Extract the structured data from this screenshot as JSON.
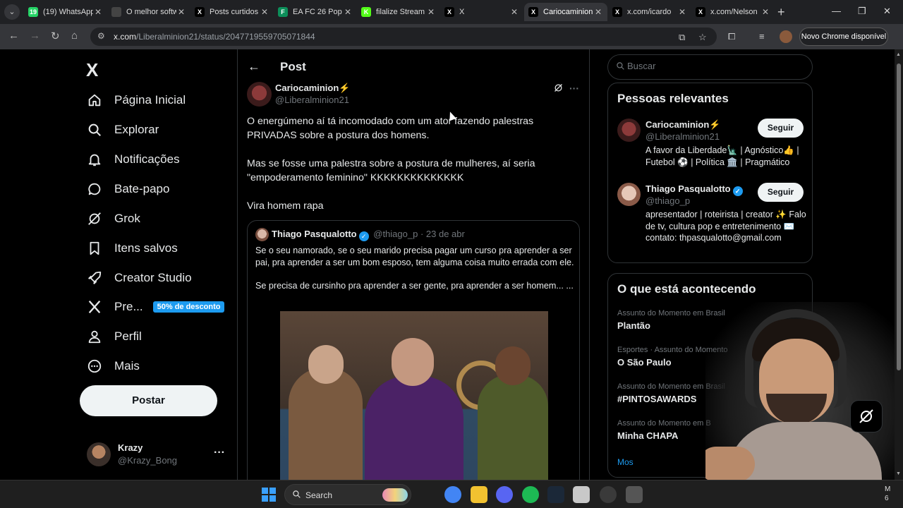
{
  "browser": {
    "tabs": [
      {
        "title": "(19) WhatsApp",
        "favicon": "whatsapp-icon",
        "color": "#25d366",
        "mark": "19"
      },
      {
        "title": "O melhor software",
        "favicon": "shield-icon",
        "color": "#444444",
        "mark": ""
      },
      {
        "title": "Posts curtidos",
        "favicon": "x-icon",
        "color": "#000000",
        "mark": "X"
      },
      {
        "title": "EA FC 26 Pop",
        "favicon": "futbin-icon",
        "color": "#0c8f5a",
        "mark": "F"
      },
      {
        "title": "filalize Stream",
        "favicon": "kick-icon",
        "color": "#53fc18",
        "mark": "K"
      },
      {
        "title": "X",
        "favicon": "x-icon",
        "color": "#000000",
        "mark": "X"
      },
      {
        "title": "Cariocaminion",
        "favicon": "x-icon",
        "color": "#000000",
        "mark": "X",
        "active": true
      },
      {
        "title": "x.com/icardo",
        "favicon": "x-icon",
        "color": "#000000",
        "mark": "X"
      },
      {
        "title": "x.com/Nelson",
        "favicon": "x-icon",
        "color": "#000000",
        "mark": "X"
      }
    ],
    "url_host": "x.com",
    "url_path": "/Liberalminion21/status/2047719559705071844",
    "update_label": "Novo Chrome disponível"
  },
  "sidebar": {
    "logo": "X",
    "items": [
      {
        "label": "Página Inicial",
        "icon": "home-icon"
      },
      {
        "label": "Explorar",
        "icon": "search-icon"
      },
      {
        "label": "Notificações",
        "icon": "bell-icon"
      },
      {
        "label": "Bate-papo",
        "icon": "chat-icon"
      },
      {
        "label": "Grok",
        "icon": "grok-icon"
      },
      {
        "label": "Itens salvos",
        "icon": "bookmark-icon"
      },
      {
        "label": "Creator Studio",
        "icon": "rocket-icon"
      },
      {
        "label": "Pre...",
        "icon": "x-premium-icon",
        "badge": "50% de desconto"
      },
      {
        "label": "Perfil",
        "icon": "person-icon"
      },
      {
        "label": "Mais",
        "icon": "more-circle-icon"
      }
    ],
    "post_button": "Postar",
    "account": {
      "name": "Krazy",
      "handle": "@Krazy_Bong"
    }
  },
  "post": {
    "header": "Post",
    "author": {
      "name": "Cariocaminion⚡",
      "handle": "@Liberalminion21"
    },
    "paragraphs": [
      "O energúmeno aí tá incomodado com um ator fazendo palestras PRIVADAS sobre a postura dos homens.",
      "Mas se fosse uma palestra sobre a postura de mulheres, aí seria \"empoderamento feminino\" KKKKKKKKKKKKKK",
      "Vira homem rapa"
    ],
    "quote": {
      "name": "Thiago Pasqualotto",
      "handle": "@thiago_p",
      "date": "23 de abr",
      "paragraphs": [
        "Se o seu namorado, se o seu marido precisa pagar um curso pra aprender a ser pai, pra aprender a ser um bom esposo, tem alguma coisa muito errada com ele.",
        "Se precisa de cursinho pra aprender a ser gente, pra aprender a ser homem... ..."
      ]
    }
  },
  "right": {
    "search_placeholder": "Buscar",
    "relevant_title": "Pessoas relevantes",
    "people": [
      {
        "name": "Cariocaminion⚡",
        "handle": "@Liberalminion21",
        "bio": "A favor da Liberdade🗽 | Agnóstico👍 | Futebol ⚽ | Política 🏛️ | Pragmático",
        "follow": "Seguir",
        "verified": false
      },
      {
        "name": "Thiago Pasqualotto",
        "handle": "@thiago_p",
        "bio": "apresentador | roteirista | creator ✨ Falo de tv, cultura pop e entretenimento ✉️ contato: thpasqualotto@gmail.com",
        "follow": "Seguir",
        "verified": true
      }
    ],
    "trends_title": "O que está acontecendo",
    "trends": [
      {
        "context": "Assunto do Momento em Brasil",
        "name": "Plantão"
      },
      {
        "context": "Esportes · Assunto do Momento",
        "name": "O São Paulo"
      },
      {
        "context": "Assunto do Momento em Brasil",
        "name": "#PINTOSAWARDS"
      },
      {
        "context": "Assunto do Momento em B",
        "name": "Minha CHAPA"
      }
    ],
    "show_more": "Mos"
  },
  "taskbar": {
    "search_label": "Search",
    "apps": [
      "chrome-icon",
      "file-explorer-icon",
      "discord-icon",
      "spotify-icon",
      "steam-icon",
      "app-icon",
      "obs-icon",
      "app-icon"
    ],
    "clock": [
      "M",
      "6"
    ]
  },
  "colors": {
    "accent": "#1d9bf0",
    "background": "#000000",
    "border": "#2f3336",
    "muted": "#71767b"
  }
}
